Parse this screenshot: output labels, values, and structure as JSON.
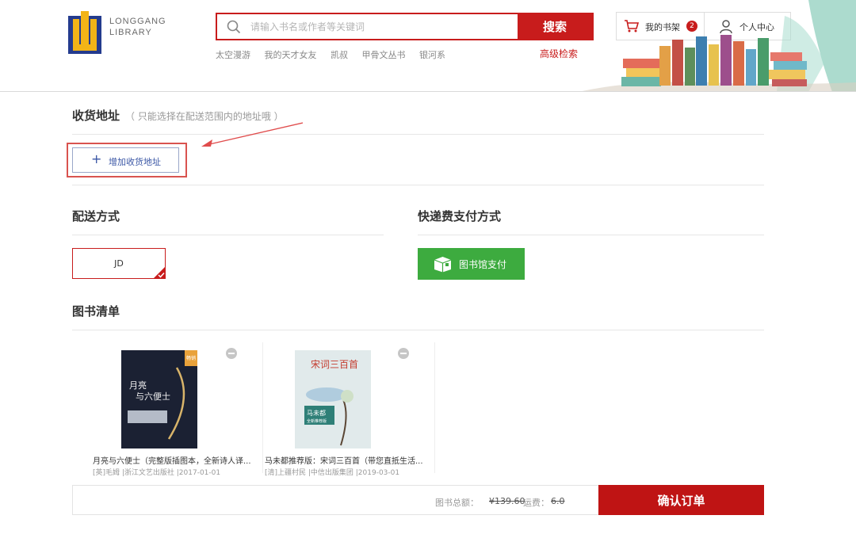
{
  "header": {
    "logo_line1": "LONGGANG",
    "logo_line2": "LIBRARY",
    "search_placeholder": "请输入书名或作者等关键词",
    "search_button": "搜索",
    "hot_words": [
      "太空漫游",
      "我的天才女友",
      "凯叔",
      "甲骨文丛书",
      "银河系"
    ],
    "advanced_search": "高级检索",
    "cart_label": "我的书架",
    "cart_count": "2",
    "user_label": "个人中心",
    "colors": {
      "brand_red": "#c81c1c",
      "pay_green": "#3dab3f"
    }
  },
  "address": {
    "title": "收货地址",
    "note": "（ 只能选择在配送范围内的地址哦 ）",
    "add_button": "增加收货地址",
    "add_icon": "plus-icon"
  },
  "shipping": {
    "title": "配送方式",
    "option": "JD"
  },
  "payment": {
    "title": "快递费支付方式",
    "option": "图书馆支付",
    "icon": "box-icon"
  },
  "booklist": {
    "title": "图书清单",
    "books": [
      {
        "title": "月亮与六便士（完整版插图本，全新诗人译...",
        "meta": "[英]毛姆 |浙江文艺出版社 |2017-01-01",
        "cover_title": "月亮与六便士",
        "cover_badge": "畅销"
      },
      {
        "title": "马未都推荐版：宋词三百首（带您直抵生活...",
        "meta": "[清]上疆村民 |中信出版集团 |2019-03-01",
        "cover_title": "宋词三百首",
        "cover_badge": "马未都全新推荐版"
      }
    ]
  },
  "footer": {
    "total_label": "图书总额：",
    "total_price": "¥139.60",
    "ship_label": "运费：",
    "ship_fee": "6.0",
    "confirm_button": "确认订单"
  }
}
